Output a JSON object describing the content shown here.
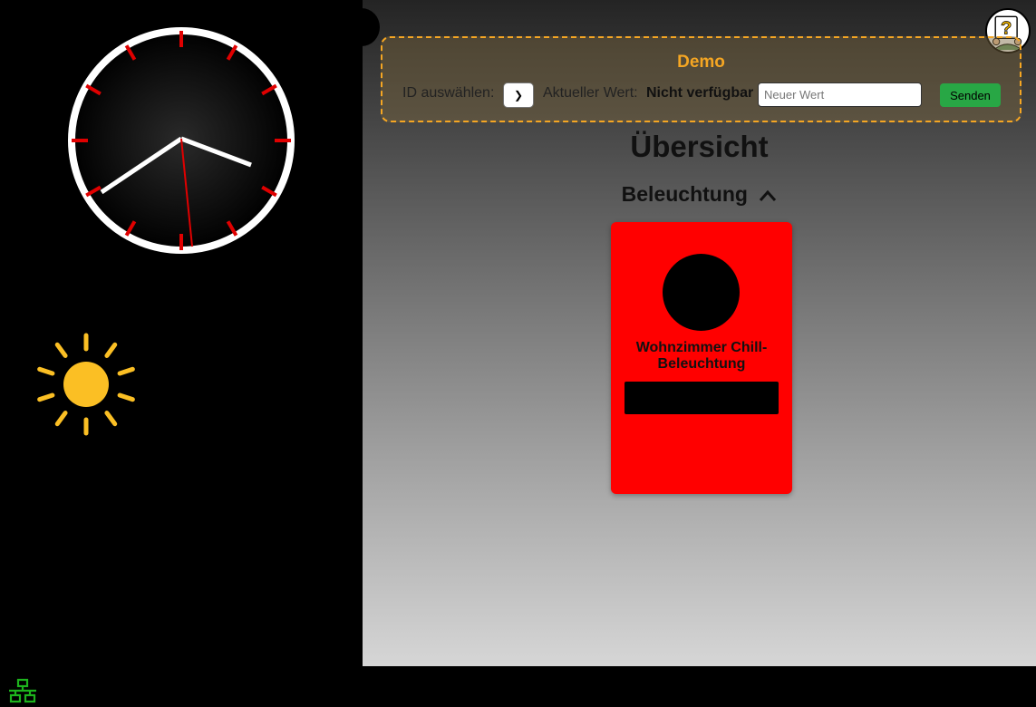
{
  "demo": {
    "title": "Demo",
    "id_label": "ID auswählen:",
    "current_label": "Aktueller Wert:",
    "current_value": "Nicht verfügbar",
    "input_placeholder": "Neuer Wert",
    "send_label": "Senden"
  },
  "page": {
    "title": "Übersicht"
  },
  "section": {
    "title": "Beleuchtung",
    "expanded": true
  },
  "cards": [
    {
      "name": "Wohnzimmer Chill-Beleuchtung",
      "color": "#ff0000"
    }
  ],
  "icons": {
    "sun": "sun-icon",
    "network": "network-icon",
    "help": "help-avatar-icon"
  },
  "colors": {
    "accent": "#f5a623",
    "send": "#28a745",
    "clock_ticks": "#e00000",
    "network": "#1db31d",
    "sun": "#fbbf24"
  }
}
